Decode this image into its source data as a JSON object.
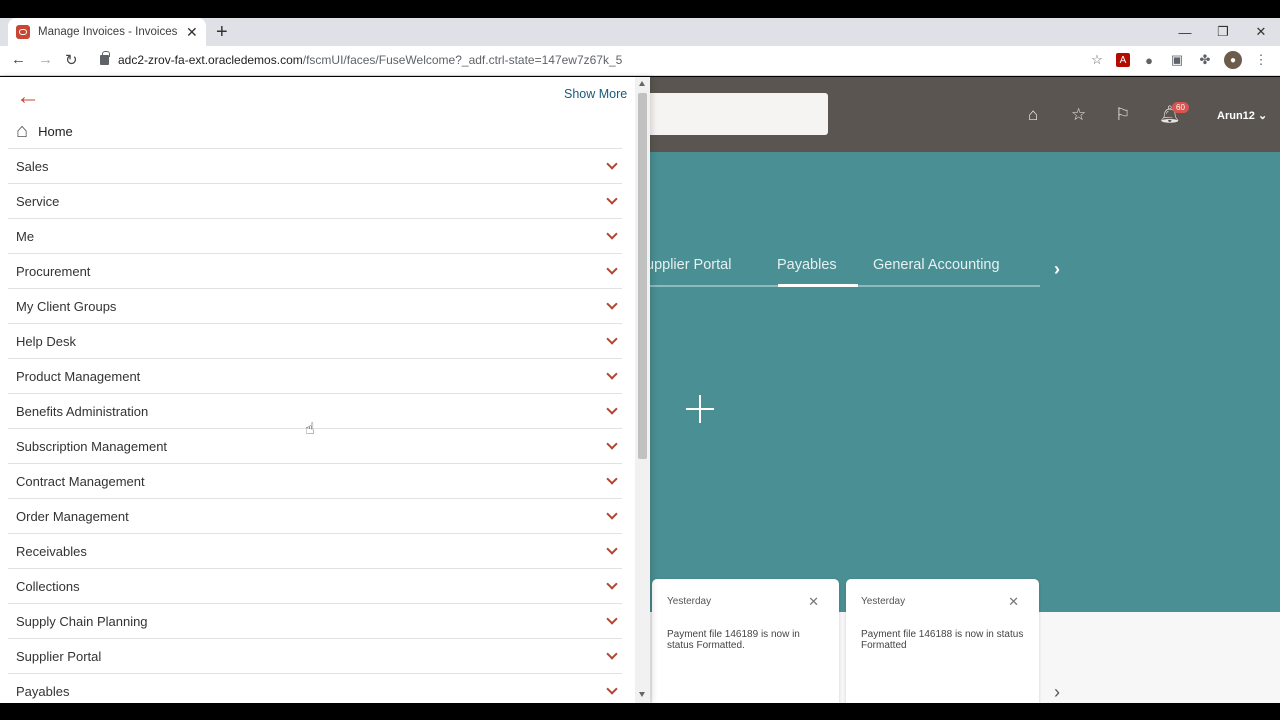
{
  "browser": {
    "tab_title": "Manage Invoices - Invoices - Oracle",
    "url_host": "adc2-zrov-fa-ext.oracledemos.com",
    "url_path": "/fscmUI/faces/FuseWelcome?_adf.ctrl-state=147ew7z67k_5"
  },
  "navigator": {
    "show_more": "Show More",
    "home_label": "Home",
    "items": [
      {
        "label": "Sales"
      },
      {
        "label": "Service"
      },
      {
        "label": "Me"
      },
      {
        "label": "Procurement"
      },
      {
        "label": "My Client Groups"
      },
      {
        "label": "Help Desk"
      },
      {
        "label": "Product Management"
      },
      {
        "label": "Benefits Administration"
      },
      {
        "label": "Subscription Management"
      },
      {
        "label": "Contract Management"
      },
      {
        "label": "Order Management"
      },
      {
        "label": "Receivables"
      },
      {
        "label": "Collections"
      },
      {
        "label": "Supply Chain Planning"
      },
      {
        "label": "Supplier Portal"
      },
      {
        "label": "Payables"
      }
    ]
  },
  "app": {
    "notification_count": "60",
    "user": "Arun12",
    "tabs": [
      "upplier Portal",
      "Payables",
      "General Accounting"
    ],
    "active_tab": "Payables",
    "cards": [
      {
        "date": "Yesterday",
        "message": "Payment file 146189 is now in status Formatted."
      },
      {
        "date": "Yesterday",
        "message": "Payment file 146188 is now in status Formatted"
      }
    ]
  },
  "colors": {
    "oracle_red": "#c74634",
    "teal_background": "#4a8f93",
    "header_brown": "#5a5550"
  }
}
